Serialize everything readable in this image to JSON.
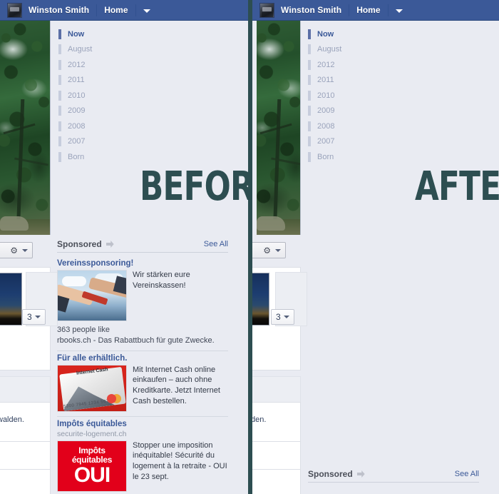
{
  "navbar": {
    "user_name": "Winston Smith",
    "home_label": "Home",
    "caret_icon": "chevron-down-icon",
    "avatar_icon": "user-avatar",
    "bar_color": "#3b5998"
  },
  "timeline": {
    "items": [
      {
        "label": "Now",
        "active": true
      },
      {
        "label": "August",
        "active": false
      },
      {
        "label": "2012",
        "active": false
      },
      {
        "label": "2011",
        "active": false
      },
      {
        "label": "2010",
        "active": false
      },
      {
        "label": "2009",
        "active": false
      },
      {
        "label": "2008",
        "active": false
      },
      {
        "label": "2007",
        "active": false
      },
      {
        "label": "Born",
        "active": false
      }
    ]
  },
  "labels": {
    "before": "BEFORE",
    "after": "AFTER",
    "accent_color": "#2d4e51"
  },
  "widgets": {
    "gear_icon": "gear-icon",
    "gear_caret_icon": "chevron-down-icon",
    "photo_count": "3",
    "photo_count_caret_icon": "chevron-down-icon",
    "post_snippet_before": "walden.",
    "post_snippet_after": "den."
  },
  "sponsored": {
    "title": "Sponsored",
    "header_icon": "sponsored-flag-icon",
    "see_all": "See All",
    "ads": [
      {
        "title": "Vereinssponsoring!",
        "subtitle": "",
        "image_icon": "handshake-photo",
        "text": "Wir stärken eure Vereinskassen!",
        "footer": "363 people like\nrbooks.ch - Das Rabattbuch für gute Zwecke."
      },
      {
        "title": "Für alle erhältlich.",
        "subtitle": "",
        "image_icon": "internet-cash-card-photo",
        "image_caption": "Internet Cash",
        "image_digits": "5300 7945 1234 5678",
        "text": "Mit Internet Cash online einkaufen – auch ohne Kreditkarte. Jetzt Internet Cash bestellen.",
        "footer": ""
      },
      {
        "title": "Impôts équitables",
        "subtitle": "securite-logement.ch",
        "image_icon": "impots-equitables-oui-poster",
        "poster_line1": "Impôts",
        "poster_line2": "équitables",
        "poster_line3": "OUI",
        "text": "Stopper une imposition inéquitable! Sécurité du logement à la retraite - OUI le 23 sept.",
        "footer": ""
      }
    ]
  },
  "after_panel": {
    "sponsored_title": "Sponsored",
    "sponsored_see_all": "See All",
    "ads_removed": true
  }
}
